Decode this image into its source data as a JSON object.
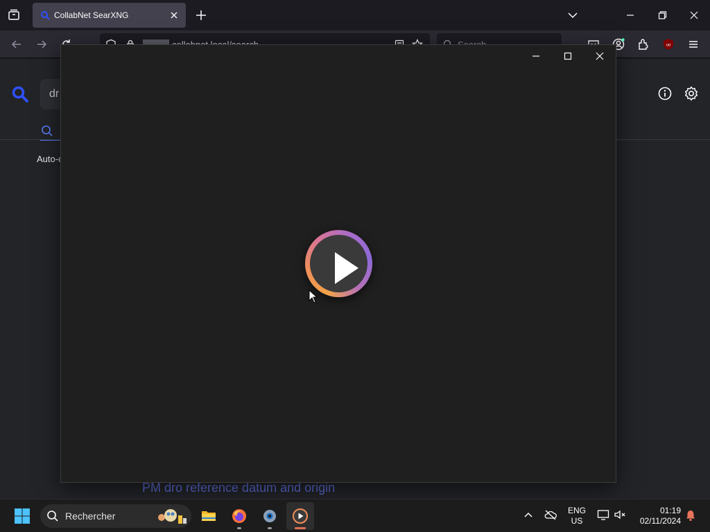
{
  "browser": {
    "tab_title": "CollabNet SearXNG",
    "url": "collabnet.local/search",
    "search_placeholder": "Search"
  },
  "page": {
    "query_fragment": "dr",
    "autocomplete_label": "Auto-c",
    "result_title": "PM dro reference datum and origin"
  },
  "taskbar": {
    "search_label": "Rechercher",
    "lang_top": "ENG",
    "lang_bottom": "US",
    "time": "01:19",
    "date": "02/11/2024"
  },
  "colors": {
    "accent": "#5c7cfa",
    "player_ring": [
      "#f1a24a",
      "#d97497",
      "#8c6ad6"
    ],
    "recording_indicator": "#e06f55"
  },
  "icons": [
    "tab-list-icon",
    "searxng-favicon",
    "close-icon",
    "plus-icon",
    "chevron-down-icon",
    "minimize-icon",
    "restore-icon",
    "back-icon",
    "forward-icon",
    "reload-icon",
    "shield-icon",
    "lock-icon",
    "reader-icon",
    "star-icon",
    "search-icon",
    "pocket-icon",
    "account-icon",
    "extensions-icon",
    "ublock-icon",
    "menu-icon",
    "info-icon",
    "gear-icon",
    "play-icon",
    "windows-start-icon",
    "file-explorer-icon",
    "firefox-icon",
    "settings-app-icon",
    "media-player-icon",
    "chevron-up-icon",
    "cloud-offline-icon",
    "monitor-icon",
    "sound-muted-icon",
    "bell-icon"
  ]
}
